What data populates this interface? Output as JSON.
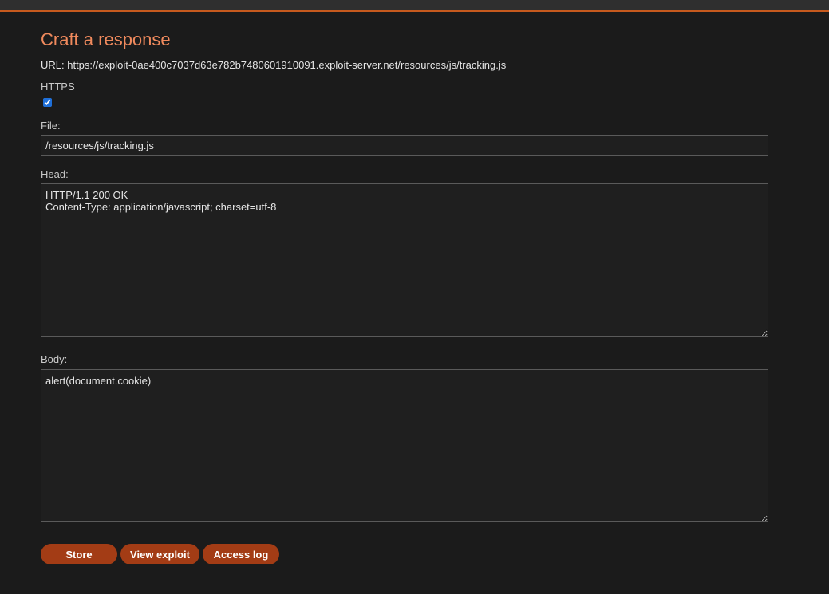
{
  "page": {
    "title": "Craft a response",
    "url_line": "URL: https://exploit-0ae400c7037d63e782b7480601910091.exploit-server.net/resources/js/tracking.js"
  },
  "form": {
    "https_label": "HTTPS",
    "https_checked": true,
    "file_label": "File:",
    "file_value": "/resources/js/tracking.js",
    "head_label": "Head:",
    "head_value": "HTTP/1.1 200 OK\nContent-Type: application/javascript; charset=utf-8",
    "body_label": "Body:",
    "body_value": "alert(document.cookie)"
  },
  "buttons": {
    "store": "Store",
    "view_exploit": "View exploit",
    "access_log": "Access log"
  },
  "colors": {
    "accent": "#c75a1e",
    "button": "#a33c15",
    "title": "#f08a5d",
    "background": "#1b1b1b"
  }
}
